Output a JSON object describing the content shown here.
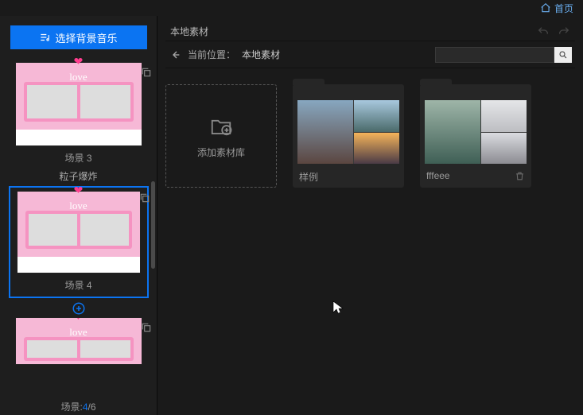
{
  "topbar": {
    "home": "首页"
  },
  "sidebar": {
    "bgm_button": "选择背景音乐",
    "scenes": [
      {
        "label": "场景 3",
        "effect": null
      },
      {
        "label": "场景 4",
        "effect": "粒子爆炸",
        "selected": true
      },
      {
        "label": ""
      }
    ],
    "counter_prefix": "场景:",
    "counter_current": "4",
    "counter_total": "/6"
  },
  "materials": {
    "header": "本地素材",
    "path_label": "当前位置：",
    "path_value": "本地素材",
    "search_placeholder": "",
    "add_library": "添加素材库",
    "folders": [
      {
        "name": "样例",
        "preview": "landscape"
      },
      {
        "name": "fffeee",
        "preview": "people",
        "deletable": true
      }
    ]
  }
}
